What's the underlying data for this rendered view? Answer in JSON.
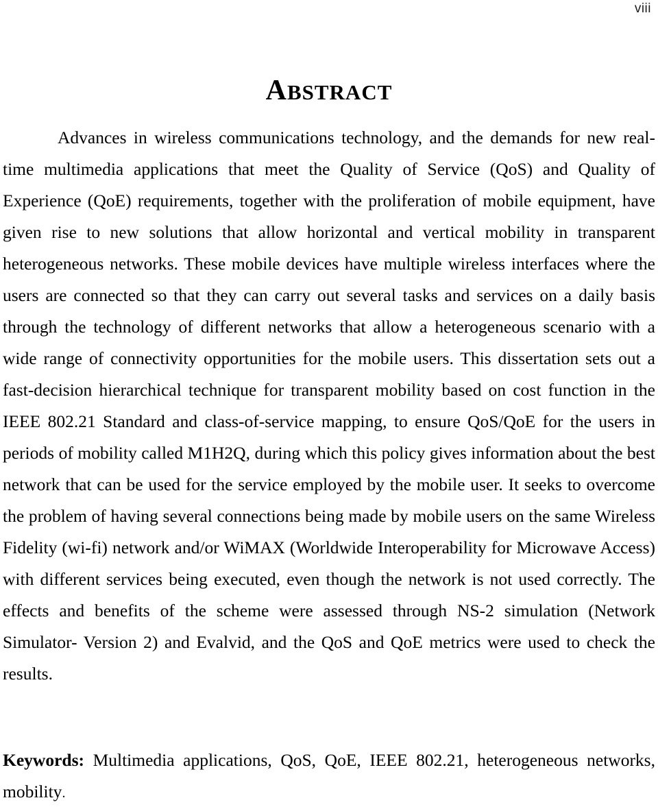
{
  "page": {
    "folio": "viii",
    "heading_first_letter": "A",
    "heading_rest": "BSTRACT",
    "heading_full": "ABSTRACT"
  },
  "abstract": {
    "paragraph": "Advances in wireless communications technology, and the demands for new real-time multimedia applications that meet the Quality of Service (QoS) and Quality of Experience (QoE) requirements, together with the proliferation of mobile equipment, have given rise to new solutions that allow horizontal and vertical mobility in transparent heterogeneous networks. These mobile devices have multiple wireless interfaces where the users are connected so that they can carry out several tasks and services on a daily basis through the technology of different networks that allow a heterogeneous scenario with a wide range of connectivity opportunities for the mobile users. This dissertation sets out a fast-decision hierarchical technique for transparent mobility based on cost function in the IEEE 802.21 Standard and class-of-service mapping, to ensure QoS/QoE for the users in periods of mobility called M1H2Q, during which this policy gives information about the best network that can be used for the service employed by the mobile user. It seeks to overcome the problem of having several connections being made by mobile users on the same Wireless Fidelity (wi-fi) network and/or WiMAX (Worldwide Interoperability for Microwave Access) with different services being executed, even though the network is not used correctly. The effects and benefits of the scheme were assessed through NS-2 simulation (Network Simulator- Version 2) and Evalvid, and the QoS and QoE metrics were used to check the results.",
    "lines": [
      "Advances in wireless communications technology, and the demands for new",
      "real-time multimedia applications that meet the Quality of Service (QoS) and Quality of",
      "Experience (QoE) requirements, together with the proliferation of mobile equipment,",
      "have given rise to new solutions that allow horizontal and vertical mobility in",
      "transparent heterogeneous networks. These mobile devices have multiple wireless",
      "interfaces where the users are connected so that they can carry out several tasks and",
      "services on a daily basis through the technology of different networks that allow a",
      "heterogeneous scenario with a wide range of connectivity opportunities for the mobile",
      "users. This dissertation sets out a fast-decision hierarchical technique for transparent",
      "mobility based on cost function in the IEEE 802.21 Standard and class-of-service",
      "mapping, to ensure QoS/QoE for the users in periods of mobility called M1H2Q, during",
      "which this policy gives information about the best network that can be used for the",
      "service employed by the mobile user. It seeks to overcome the problem of having",
      "several connections being made by mobile users on the same Wireless Fidelity (wi-fi)",
      "network and/or WiMAX (Worldwide Interoperability for Microwave Access) with",
      "different services being executed, even though the network is not used correctly. The",
      "effects and benefits of the scheme were assessed through NS-2 simulation (Network",
      "Simulator- Version 2) and Evalvid, and the QoS and QoE metrics were used to check",
      "the results."
    ]
  },
  "keywords": {
    "label": "Keywords:",
    "list": " Multimedia applications, QoS, QoE, IEEE 802.21, heterogeneous networks, mobility",
    "terminator": "."
  }
}
